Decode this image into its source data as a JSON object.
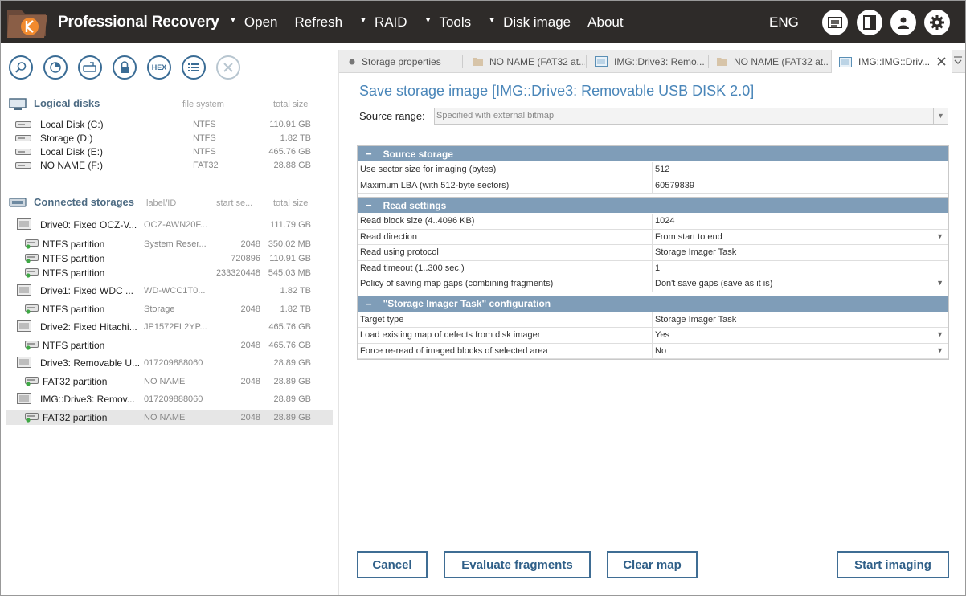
{
  "app": {
    "title": "Professional Recovery"
  },
  "menu": {
    "items": [
      {
        "label": "Open",
        "dropdown": true
      },
      {
        "label": "Refresh",
        "dropdown": false
      },
      {
        "label": "RAID",
        "dropdown": true
      },
      {
        "label": "Tools",
        "dropdown": true
      },
      {
        "label": "Disk image",
        "dropdown": true
      },
      {
        "label": "About",
        "dropdown": false
      }
    ],
    "language": "ENG"
  },
  "toolbar_icons": [
    "search-icon",
    "scan-icon",
    "open-image-icon",
    "lock-icon",
    "hex-editor-icon",
    "list-icon",
    "close-icon"
  ],
  "hex_label": "HEX",
  "logical": {
    "title": "Logical disks",
    "col_fs": "file system",
    "col_size": "total size",
    "items": [
      {
        "name": "Local Disk (C:)",
        "fs": "NTFS",
        "size": "110.91 GB"
      },
      {
        "name": "Storage (D:)",
        "fs": "NTFS",
        "size": "1.82 TB"
      },
      {
        "name": "Local Disk (E:)",
        "fs": "NTFS",
        "size": "465.76 GB"
      },
      {
        "name": "NO NAME (F:)",
        "fs": "FAT32",
        "size": "28.88 GB"
      }
    ]
  },
  "storages": {
    "title": "Connected storages",
    "col_label": "label/ID",
    "col_start": "start se...",
    "col_size": "total size",
    "items": [
      {
        "name": "Drive0: Fixed OCZ-V...",
        "label": "OCZ-AWN20F...",
        "start": "",
        "size": "111.79 GB",
        "kind": "drive"
      },
      {
        "name": "NTFS partition",
        "label": "System Reser...",
        "start": "2048",
        "size": "350.02 MB",
        "kind": "part"
      },
      {
        "name": "NTFS partition",
        "label": "",
        "start": "720896",
        "size": "110.91 GB",
        "kind": "part"
      },
      {
        "name": "NTFS partition",
        "label": "",
        "start": "233320448",
        "size": "545.03 MB",
        "kind": "part"
      },
      {
        "name": "Drive1: Fixed WDC ...",
        "label": "WD-WCC1T0...",
        "start": "",
        "size": "1.82 TB",
        "kind": "drive"
      },
      {
        "name": "NTFS partition",
        "label": "Storage",
        "start": "2048",
        "size": "1.82 TB",
        "kind": "part"
      },
      {
        "name": "Drive2: Fixed Hitachi...",
        "label": "JP1572FL2YP...",
        "start": "",
        "size": "465.76 GB",
        "kind": "drive"
      },
      {
        "name": "NTFS partition",
        "label": "",
        "start": "2048",
        "size": "465.76 GB",
        "kind": "part"
      },
      {
        "name": "Drive3: Removable U...",
        "label": "017209888060",
        "start": "",
        "size": "28.89 GB",
        "kind": "drive"
      },
      {
        "name": "FAT32 partition",
        "label": "NO NAME",
        "start": "2048",
        "size": "28.89 GB",
        "kind": "part"
      },
      {
        "name": "IMG::Drive3: Remov...",
        "label": "017209888060",
        "start": "",
        "size": "28.89 GB",
        "kind": "drive"
      },
      {
        "name": "FAT32 partition",
        "label": "NO NAME",
        "start": "2048",
        "size": "28.89 GB",
        "kind": "part"
      }
    ]
  },
  "tabs": [
    {
      "label": "Storage properties",
      "icon": "dot-icon"
    },
    {
      "label": "NO NAME (FAT32 at...",
      "icon": "folder-icon"
    },
    {
      "label": "IMG::Drive3: Remo...",
      "icon": "disk-image-icon"
    },
    {
      "label": "NO NAME (FAT32 at...",
      "icon": "folder-icon"
    },
    {
      "label": "IMG::IMG::Driv...",
      "icon": "disk-image-icon"
    }
  ],
  "page": {
    "title": "Save storage image [IMG::Drive3: Removable USB DISK 2.0]",
    "source_label": "Source range:",
    "source_value": "Specified with external bitmap"
  },
  "groups": [
    {
      "title": "Source storage",
      "rows": [
        {
          "key": "Use sector size for imaging (bytes)",
          "value": "512",
          "dropdown": false
        },
        {
          "key": "Maximum LBA (with 512-byte sectors)",
          "value": "60579839",
          "dropdown": false
        }
      ]
    },
    {
      "title": "Read settings",
      "rows": [
        {
          "key": "Read block size (4..4096 KB)",
          "value": "1024",
          "dropdown": false
        },
        {
          "key": "Read direction",
          "value": "From start to end",
          "dropdown": true
        },
        {
          "key": "Read using protocol",
          "value": "Storage Imager Task",
          "dropdown": false
        },
        {
          "key": "Read timeout (1..300 sec.)",
          "value": "1",
          "dropdown": false
        },
        {
          "key": "Policy of saving map gaps (combining fragments)",
          "value": "Don't save gaps (save as it is)",
          "dropdown": true
        }
      ]
    },
    {
      "title": "\"Storage Imager Task\" configuration",
      "rows": [
        {
          "key": "Target type",
          "value": "Storage Imager Task",
          "dropdown": false
        },
        {
          "key": "Load existing map of defects from disk imager",
          "value": "Yes",
          "dropdown": true
        },
        {
          "key": "Force re-read of imaged blocks of selected area",
          "value": "No",
          "dropdown": true
        }
      ]
    }
  ],
  "buttons": {
    "cancel": "Cancel",
    "evaluate": "Evaluate fragments",
    "clear": "Clear map",
    "start": "Start imaging"
  }
}
